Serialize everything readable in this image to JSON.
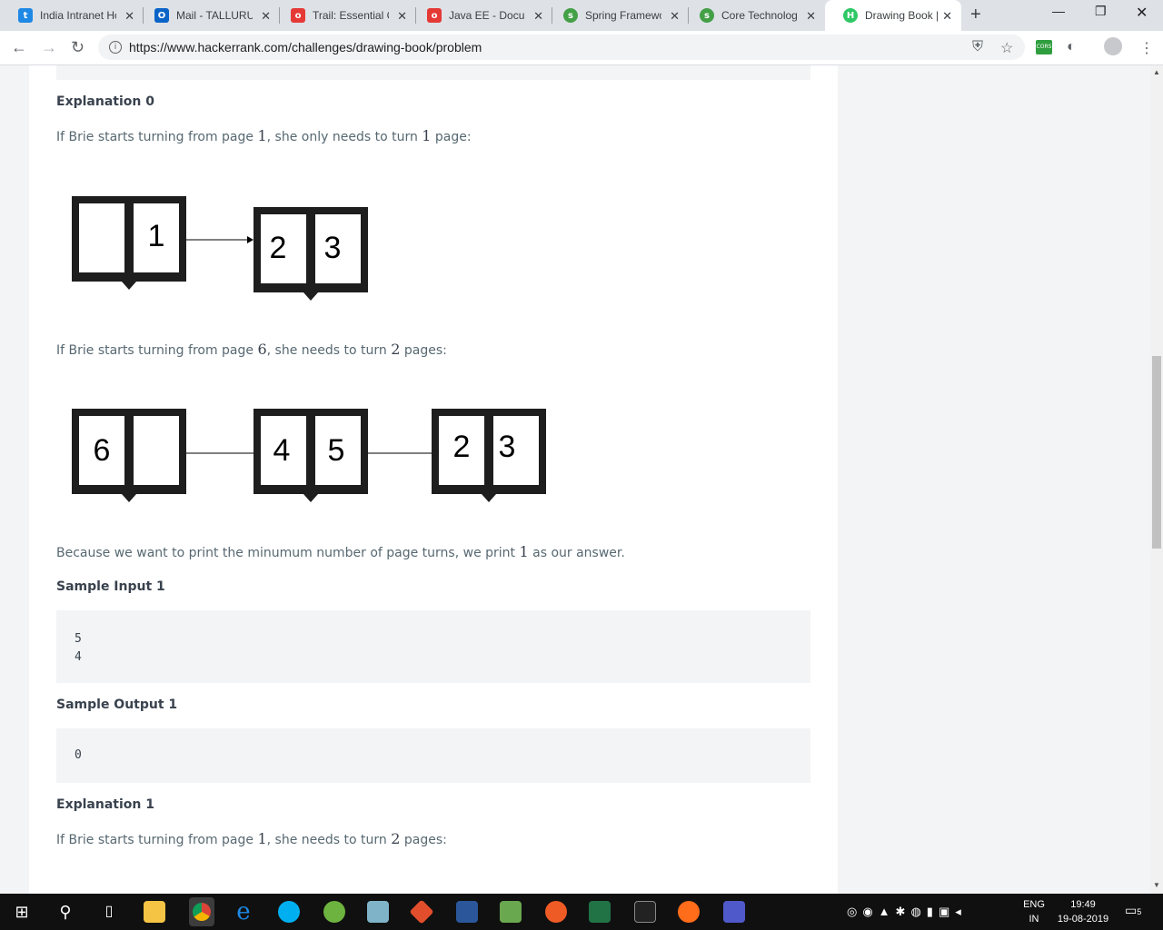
{
  "browser": {
    "tabs": [
      {
        "title": "India Intranet Ho",
        "color": "#1e88e5",
        "glyph": "t"
      },
      {
        "title": "Mail - TALLURU",
        "color": "#0a64c8",
        "glyph": "O"
      },
      {
        "title": "Trail: Essential C",
        "color": "#e53935",
        "glyph": "o"
      },
      {
        "title": "Java EE - Docum",
        "color": "#e53935",
        "glyph": "o"
      },
      {
        "title": "Spring Framewo",
        "color": "#43a047",
        "glyph": "s"
      },
      {
        "title": "Core Technolog",
        "color": "#43a047",
        "glyph": "s"
      },
      {
        "title": "Drawing Book |",
        "color": "#2ec866",
        "glyph": "H",
        "active": true
      }
    ],
    "url": "https://www.hackerrank.com/challenges/drawing-book/problem"
  },
  "content": {
    "explanation0_heading": "Explanation 0",
    "e0_line1": {
      "pre": "If Brie starts turning from page ",
      "n1": "1",
      "mid": ", she only needs to turn ",
      "n2": "1",
      "post": " page:"
    },
    "e0_line2": {
      "pre": "If Brie starts turning from page ",
      "n1": "6",
      "mid": ", she needs to turn ",
      "n2": "2",
      "post": " pages:"
    },
    "e0_line3": {
      "pre": "Because we want to print the minumum number of page turns, we print ",
      "n1": "1",
      "post": " as our answer."
    },
    "sample_input_heading": "Sample Input 1",
    "sample_input": "5\n4",
    "sample_output_heading": "Sample Output 1",
    "sample_output": "0",
    "explanation1_heading": "Explanation 1",
    "e1_line1": {
      "pre": "If Brie starts turning from page ",
      "n1": "1",
      "mid": ", she needs to turn ",
      "n2": "2",
      "post": " pages:"
    },
    "diagram1": {
      "books": [
        [
          "",
          "1"
        ],
        [
          "2",
          "3"
        ]
      ]
    },
    "diagram2": {
      "books": [
        [
          "6",
          ""
        ],
        [
          "4",
          "5"
        ],
        [
          "2",
          "3"
        ]
      ]
    }
  },
  "taskbar": {
    "language": "ENG",
    "region": "IN",
    "time": "19:49",
    "date": "19-08-2019",
    "notifications": "5"
  }
}
